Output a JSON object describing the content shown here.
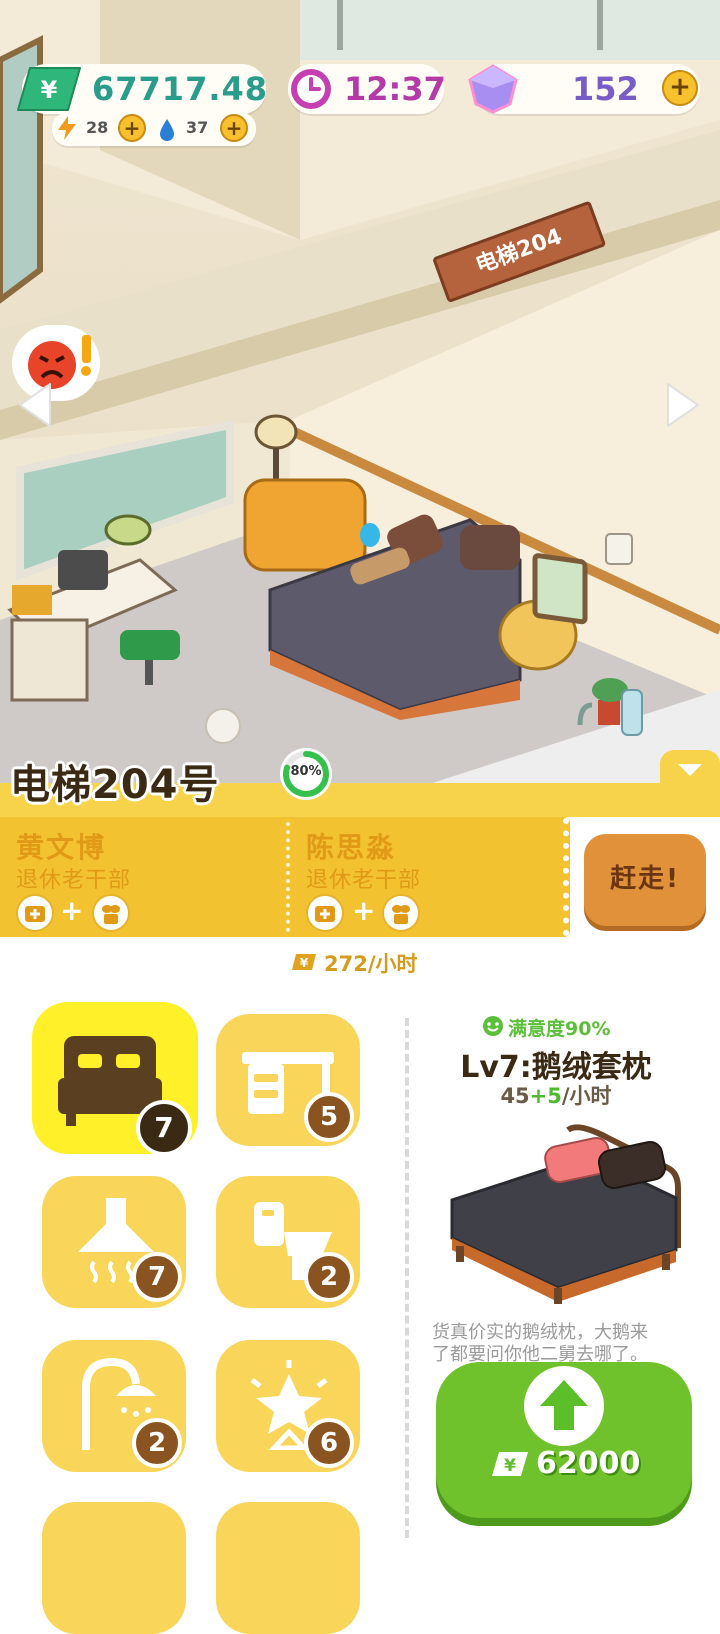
{
  "hud": {
    "money": "67717.48",
    "energy": "28",
    "water": "37",
    "clock": "12:37",
    "gems": "152",
    "money_icon": "yuan-bill-icon",
    "clock_icon": "clock-icon",
    "gem_icon": "diamond-icon"
  },
  "scene": {
    "room_sign": "电梯204",
    "alert_icon": "angry-face-alert-icon",
    "nav_left_icon": "arrow-left-icon",
    "nav_right_icon": "arrow-right-icon"
  },
  "room": {
    "title": "电梯204号",
    "occupancy": "80%",
    "occupancy_fraction": 0.8,
    "income": "272/小时",
    "kick_button": "赶走!",
    "tenants": [
      {
        "name": "黄文博",
        "role": "退休老干部",
        "needs": [
          "medical-kit-icon",
          "plant-icon"
        ]
      },
      {
        "name": "陈思淼",
        "role": "退休老干部",
        "needs": [
          "medical-kit-icon",
          "plant-icon"
        ]
      }
    ]
  },
  "furniture": [
    {
      "icon": "bed-icon",
      "level": "7",
      "selected": true
    },
    {
      "icon": "desk-icon",
      "level": "5"
    },
    {
      "icon": "range-hood-icon",
      "level": "7"
    },
    {
      "icon": "toilet-icon",
      "level": "2"
    },
    {
      "icon": "shower-icon",
      "level": "2"
    },
    {
      "icon": "lamp-icon",
      "level": "6"
    }
  ],
  "detail": {
    "satisfaction": "满意度90%",
    "item_name": "Lv7:鹅绒套枕",
    "income_base": "45",
    "income_bonus": "+5",
    "income_unit": "/小时",
    "description_line1": "货真价实的鹅绒枕，大鹅来",
    "description_line2": "了都要问你他二舅去哪了。",
    "upgrade_cost": "62000",
    "upgrade_icon": "arrow-up-icon"
  },
  "colors": {
    "accent_yellow": "#f7d34b",
    "money_green": "#2fb67a",
    "upgrade_green": "#6fc22b",
    "gem_purple": "#7a5cc8"
  }
}
